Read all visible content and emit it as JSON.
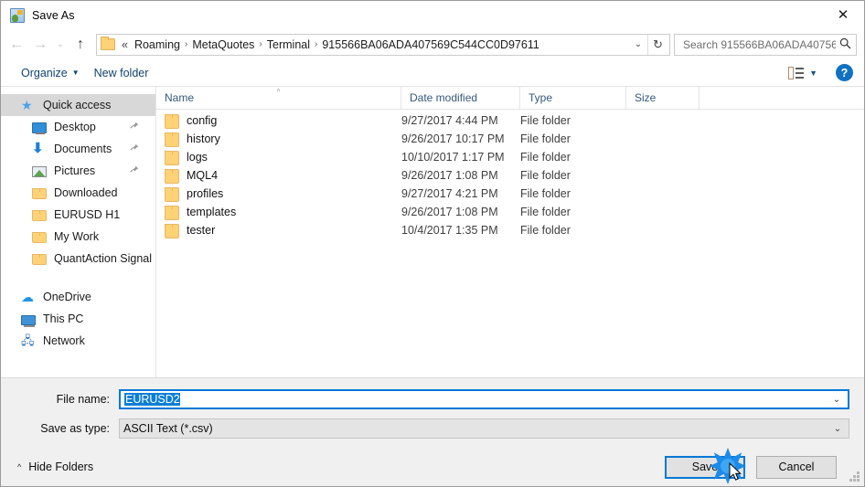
{
  "window": {
    "title": "Save As",
    "app_icon": "metatrader-icon",
    "close_label": "✕"
  },
  "nav": {
    "back": "←",
    "forward": "→",
    "recent": "⌄",
    "up": "↑",
    "refresh": "↻",
    "dropdown": "⌄",
    "breadcrumb_prefix": "«",
    "breadcrumbs": [
      "Roaming",
      "MetaQuotes",
      "Terminal",
      "915566BA06ADA407569C544CC0D97611"
    ],
    "separator": "›"
  },
  "search": {
    "placeholder": "Search 915566BA06ADA40756...",
    "value": "",
    "icon": "search-icon"
  },
  "command_bar": {
    "organize": "Organize",
    "organize_caret": "▼",
    "new_folder": "New folder",
    "view_caret": "▼",
    "help": "?"
  },
  "sidebar": {
    "items": [
      {
        "label": "Quick access",
        "icon": "star-icon",
        "level": "root",
        "selected": true,
        "pinned": false
      },
      {
        "label": "Desktop",
        "icon": "desktop-icon",
        "level": "child",
        "selected": false,
        "pinned": true
      },
      {
        "label": "Documents",
        "icon": "download-arrow-icon",
        "level": "child",
        "selected": false,
        "pinned": true
      },
      {
        "label": "Pictures",
        "icon": "picture-icon",
        "level": "child",
        "selected": false,
        "pinned": true
      },
      {
        "label": "Downloaded",
        "icon": "folder-icon",
        "level": "child",
        "selected": false,
        "pinned": false
      },
      {
        "label": "EURUSD H1",
        "icon": "folder-icon",
        "level": "child",
        "selected": false,
        "pinned": false
      },
      {
        "label": "My Work",
        "icon": "folder-icon",
        "level": "child",
        "selected": false,
        "pinned": false
      },
      {
        "label": "QuantAction Signal",
        "icon": "folder-icon",
        "level": "child",
        "selected": false,
        "pinned": false
      },
      {
        "label": "",
        "icon": "spacer",
        "level": "spacer",
        "selected": false,
        "pinned": false
      },
      {
        "label": "OneDrive",
        "icon": "cloud-icon",
        "level": "root",
        "selected": false,
        "pinned": false
      },
      {
        "label": "This PC",
        "icon": "pc-icon",
        "level": "root",
        "selected": false,
        "pinned": false
      },
      {
        "label": "Network",
        "icon": "network-icon",
        "level": "root",
        "selected": false,
        "pinned": false
      }
    ],
    "pin_glyph": "📌"
  },
  "file_list": {
    "columns": [
      "Name",
      "Date modified",
      "Type",
      "Size"
    ],
    "sort_caret": "^",
    "rows": [
      {
        "name": "config",
        "date": "9/27/2017 4:44 PM",
        "type": "File folder",
        "size": ""
      },
      {
        "name": "history",
        "date": "9/26/2017 10:17 PM",
        "type": "File folder",
        "size": ""
      },
      {
        "name": "logs",
        "date": "10/10/2017 1:17 PM",
        "type": "File folder",
        "size": ""
      },
      {
        "name": "MQL4",
        "date": "9/26/2017 1:08 PM",
        "type": "File folder",
        "size": ""
      },
      {
        "name": "profiles",
        "date": "9/27/2017 4:21 PM",
        "type": "File folder",
        "size": ""
      },
      {
        "name": "templates",
        "date": "9/26/2017 1:08 PM",
        "type": "File folder",
        "size": ""
      },
      {
        "name": "tester",
        "date": "10/4/2017 1:35 PM",
        "type": "File folder",
        "size": ""
      }
    ]
  },
  "footer": {
    "file_name_label": "File name:",
    "file_name_value": "EURUSD2",
    "save_as_type_label": "Save as type:",
    "save_as_type_value": "ASCII Text (*.csv)",
    "combo_caret": "⌄",
    "hide_folders": "Hide Folders",
    "hide_folders_caret": "^",
    "save_button": "Save",
    "cancel_button": "Cancel"
  },
  "colors": {
    "accent": "#0078d7",
    "link_text": "#12436e",
    "selection": "#0b7fd4",
    "folder": "#ffd277",
    "selected_row": "#d8d8d8"
  }
}
